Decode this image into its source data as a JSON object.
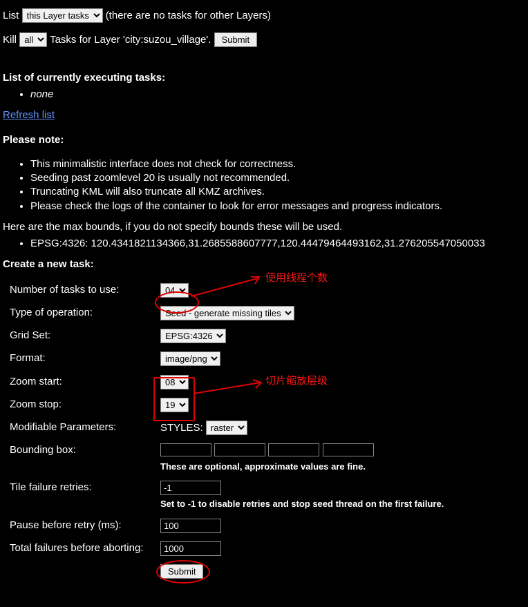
{
  "top": {
    "list_label": "List",
    "list_note": "(there are no tasks for other Layers)",
    "layer_filter_selected": "this Layer tasks",
    "kill_label": "Kill",
    "kill_scope_selected": "all",
    "kill_suffix": "Tasks for Layer 'city:suzou_village'.",
    "kill_submit": "Submit"
  },
  "executing": {
    "heading": "List of currently executing tasks:",
    "none": "none",
    "refresh": "Refresh list"
  },
  "notes": {
    "heading": "Please note:",
    "items": [
      "This minimalistic interface does not check for correctness.",
      "Seeding past zoomlevel 20 is usually not recommended.",
      "Truncating KML will also truncate all KMZ archives.",
      "Please check the logs of the container to look for error messages and progress indicators."
    ],
    "bounds_intro": "Here are the max bounds, if you do not specify bounds these will be used.",
    "bounds_item": "EPSG:4326: 120.4341821134366,31.2685588607777,120.44479464493162,31.276205547050033"
  },
  "create": {
    "heading": "Create a new task:",
    "rows": {
      "tasks_label": "Number of tasks to use:",
      "tasks_value": "04",
      "op_label": "Type of operation:",
      "op_value": "Seed - generate missing tiles",
      "gridset_label": "Grid Set:",
      "gridset_value": "EPSG:4326",
      "format_label": "Format:",
      "format_value": "image/png",
      "zoom_start_label": "Zoom start:",
      "zoom_start_value": "08",
      "zoom_stop_label": "Zoom stop:",
      "zoom_stop_value": "19",
      "mod_params_label": "Modifiable Parameters:",
      "styles_label": "STYLES:",
      "styles_value": "raster",
      "bbox_label": "Bounding box:",
      "bbox_help": "These are optional, approximate values are fine.",
      "retries_label": "Tile failure retries:",
      "retries_value": "-1",
      "retries_help": "Set to -1 to disable retries and stop seed thread on the first failure.",
      "pause_label": "Pause before retry (ms):",
      "pause_value": "100",
      "total_fail_label": "Total failures before aborting:",
      "total_fail_value": "1000",
      "submit": "Submit"
    }
  },
  "annotations": {
    "threads_note": "使用线程个数",
    "zoom_note": "切片缩放层级"
  }
}
